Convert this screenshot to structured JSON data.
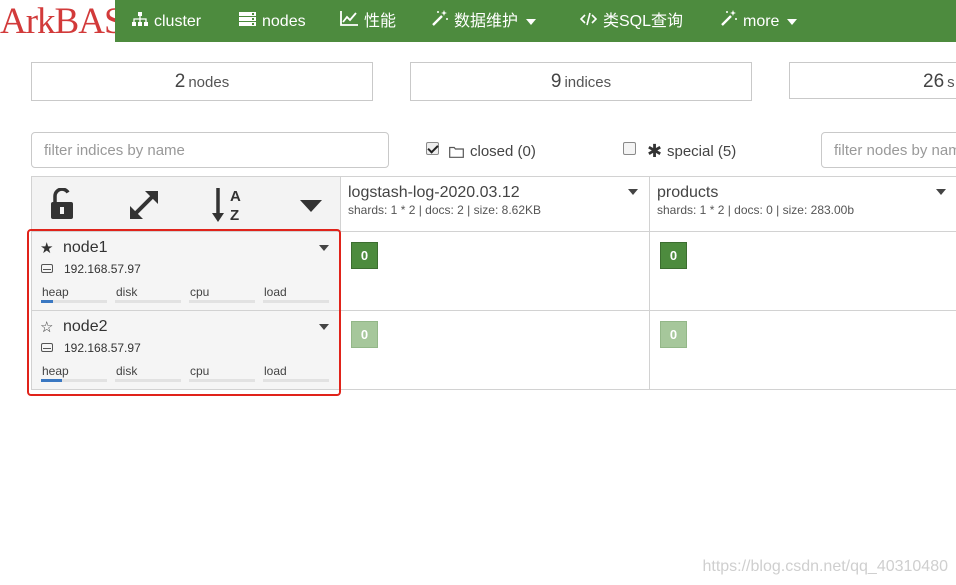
{
  "brand": {
    "logo_text": "ArkBASE"
  },
  "nav": {
    "items": [
      {
        "label": "cluster",
        "icon": "sitemap-icon"
      },
      {
        "label": "nodes",
        "icon": "server-icon"
      },
      {
        "label": "性能",
        "icon": "line-chart-icon"
      },
      {
        "label": "数据维护",
        "icon": "magic-wand-icon",
        "dropdown": true
      },
      {
        "label": "类SQL查询",
        "icon": "code-icon"
      },
      {
        "label": "more",
        "icon": "magic-wand-icon",
        "dropdown": true
      }
    ]
  },
  "summary": [
    {
      "value": "2",
      "unit": "nodes"
    },
    {
      "value": "9",
      "unit": "indices"
    },
    {
      "value": "26",
      "unit": "s"
    }
  ],
  "filters": {
    "indices_placeholder": "filter indices by name",
    "nodes_placeholder": "filter nodes by nam",
    "closed": {
      "label": "closed (0)",
      "checked": true
    },
    "special": {
      "label": "special (5)",
      "checked": false
    }
  },
  "indices": [
    {
      "name": "logstash-log-2020.03.12",
      "meta": "shards: 1 * 2 | docs: 2 | size: 8.62KB"
    },
    {
      "name": "products",
      "meta": "shards: 1 * 2 | docs: 0 | size: 283.00b"
    }
  ],
  "nodes": [
    {
      "name": "node1",
      "ip": "192.168.57.97",
      "master": true,
      "metrics": [
        {
          "label": "heap",
          "fill": 0.18
        },
        {
          "label": "disk",
          "fill": 0
        },
        {
          "label": "cpu",
          "fill": 0
        },
        {
          "label": "load",
          "fill": 0
        }
      ],
      "shards": [
        {
          "value": "0",
          "kind": "primary"
        },
        {
          "value": "0",
          "kind": "primary"
        }
      ]
    },
    {
      "name": "node2",
      "ip": "192.168.57.97",
      "master": false,
      "metrics": [
        {
          "label": "heap",
          "fill": 0.32
        },
        {
          "label": "disk",
          "fill": 0
        },
        {
          "label": "cpu",
          "fill": 0
        },
        {
          "label": "load",
          "fill": 0
        }
      ],
      "shards": [
        {
          "value": "0",
          "kind": "replica"
        },
        {
          "value": "0",
          "kind": "replica"
        }
      ]
    }
  ],
  "colors": {
    "nav_bg": "#4d8b3e",
    "logo": "#d23a3a",
    "highlight": "#e0231a",
    "primary_shard": "#4d8b3e",
    "replica_shard": "#a6c79b",
    "heap_bar": "#3a78c2"
  },
  "watermark": "https://blog.csdn.net/qq_40310480"
}
